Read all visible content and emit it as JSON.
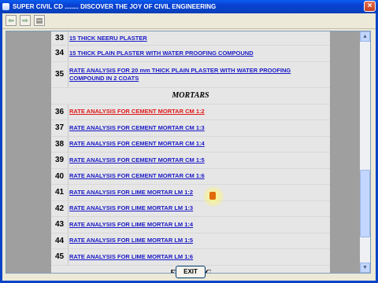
{
  "window": {
    "title": "SUPER CIVIL CD ........ DISCOVER THE JOY OF CIVIL ENGINEERING",
    "close_label": "×"
  },
  "toolbar": {
    "back_icon": "back-arrow-icon",
    "forward_icon": "forward-arrow-icon",
    "page_icon": "page-icon"
  },
  "rows_top": [
    {
      "num": "33",
      "text": "15 THICK NEERU PLASTER"
    },
    {
      "num": "34",
      "text": "15 THICK PLAIN PLASTER WITH WATER PROOFING COMPOUND"
    },
    {
      "num": "35",
      "text": "RATE ANALYSIS FOR 20 mm THICK PLAIN PLASTER  WITH WATER PROOFING COMPOUND IN 2 COATS"
    }
  ],
  "section_mortars": "MORTARS",
  "rows_mortar": [
    {
      "num": "36",
      "text": "RATE ANALYSIS FOR CEMENT MORTAR CM 1:2"
    },
    {
      "num": "37",
      "text": "RATE ANALYSIS FOR CEMENT MORTAR CM 1:3"
    },
    {
      "num": "38",
      "text": "RATE ANALYSIS FOR CEMENT MORTAR CM 1:4"
    },
    {
      "num": "39",
      "text": "RATE ANALYSIS FOR CEMENT MORTAR CM 1:5"
    },
    {
      "num": "40",
      "text": "RATE ANALYSIS FOR CEMENT MORTAR CM 1:6"
    },
    {
      "num": "41",
      "text": "RATE ANALYSIS FOR LIME MORTAR LM 1:2"
    },
    {
      "num": "42",
      "text": "RATE ANALYSIS FOR LIME MORTAR LM 1:3"
    },
    {
      "num": "43",
      "text": "RATE ANALYSIS FOR LIME MORTAR LM 1:4"
    },
    {
      "num": "44",
      "text": "RATE ANALYSIS FOR LIME MORTAR LM 1:5"
    },
    {
      "num": "45",
      "text": "RATE ANALYSIS FOR LIME MORTAR LM 1:6"
    }
  ],
  "section_flooring": "FLOORING",
  "exit_label": "EXIT",
  "colors": {
    "link": "#1a1ac8",
    "active_link": "#e01818",
    "titlebar": "#0a4fe0"
  }
}
